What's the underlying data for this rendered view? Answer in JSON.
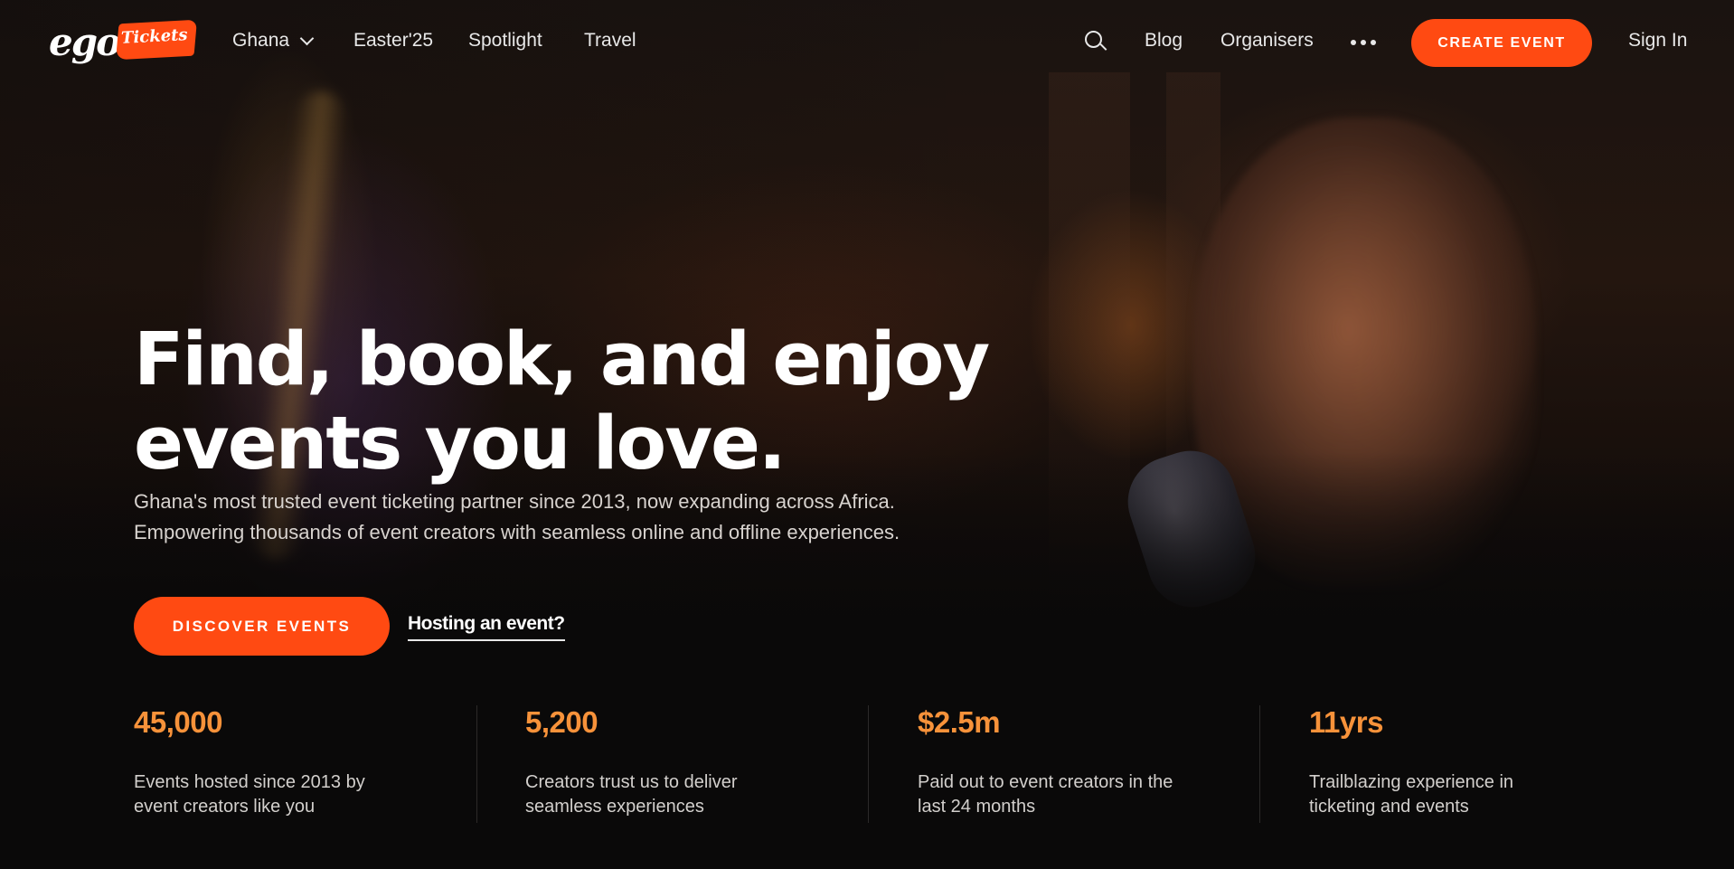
{
  "logo": {
    "main": "ego",
    "badge": "Tickets"
  },
  "nav": {
    "country": "Ghana",
    "links": [
      "Easter'25",
      "Spotlight",
      "Travel"
    ],
    "right_links": [
      "Blog",
      "Organisers"
    ],
    "create_label": "CREATE EVENT",
    "signin_label": "Sign In"
  },
  "hero": {
    "title_line1": "Find, book, and enjoy",
    "title_line2": "events you love.",
    "sub_line1": "Ghana's most trusted event ticketing partner since 2013, now expanding across Africa.",
    "sub_line2": "Empowering thousands of event creators with seamless online and offline experiences.",
    "discover_label": "DISCOVER EVENTS",
    "hosting_label": "Hosting an event?"
  },
  "stats": [
    {
      "value": "45,000",
      "line1": "Events hosted since 2013 by",
      "line2": "event creators like you"
    },
    {
      "value": "5,200",
      "line1": "Creators trust us to deliver",
      "line2": "seamless experiences"
    },
    {
      "value": "$2.5m",
      "line1": "Paid out to event creators in the",
      "line2": "last 24 months"
    },
    {
      "value": "11yrs",
      "line1": "Trailblazing experience in",
      "line2": "ticketing and events"
    }
  ],
  "colors": {
    "accent": "#ff4a12",
    "stat_number": "#f7923a",
    "background": "#0a0909"
  }
}
